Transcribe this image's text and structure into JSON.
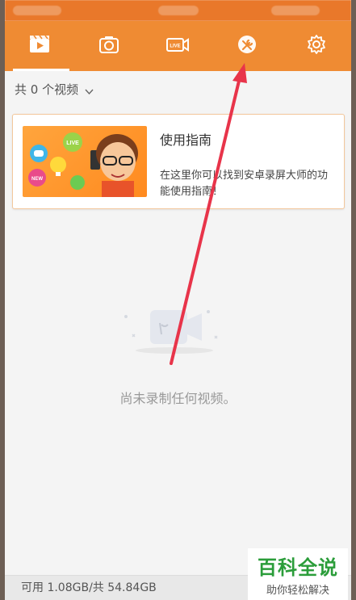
{
  "tabs": [
    {
      "icon": "video-clip-icon"
    },
    {
      "icon": "camera-icon"
    },
    {
      "icon": "live-camera-icon"
    },
    {
      "icon": "tools-icon"
    },
    {
      "icon": "gear-icon"
    }
  ],
  "filter": {
    "label": "共 0 个视频"
  },
  "guide_card": {
    "title": "使用指南",
    "description": "在这里你可以找到安卓录屏大师的功能使用指南！",
    "thumb_badges": [
      "LIVE",
      "NEW"
    ]
  },
  "empty_state": {
    "message": "尚未录制任何视频。"
  },
  "footer": {
    "storage": "可用 1.08GB/共 54.84GB"
  },
  "watermark": {
    "brand": "百科全说",
    "slogan": "助你轻松解决"
  },
  "colors": {
    "accent": "#ef8b33",
    "annotation_arrow": "#e8344a",
    "watermark_green": "#2b9d3a"
  }
}
